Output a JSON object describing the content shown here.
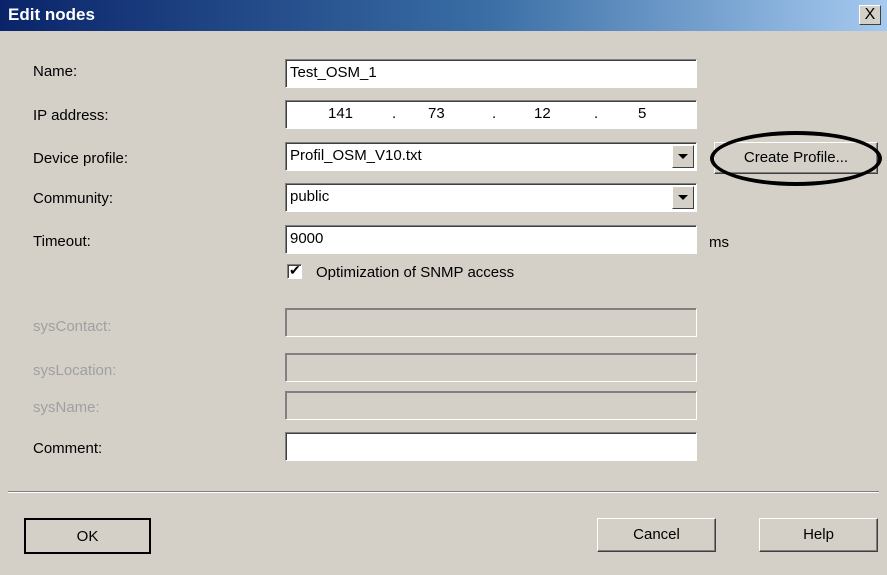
{
  "window": {
    "title": "Edit nodes",
    "close_glyph": "X"
  },
  "labels": {
    "name": "Name:",
    "ip": "IP address:",
    "device_profile": "Device profile:",
    "community": "Community:",
    "timeout": "Timeout:",
    "sys_contact": "sysContact:",
    "sys_location": "sysLocation:",
    "sys_name": "sysName:",
    "comment": "Comment:"
  },
  "fields": {
    "name": "Test_OSM_1",
    "ip": [
      "141",
      "73",
      "12",
      "5"
    ],
    "ip_dot": ".",
    "device_profile": "Profil_OSM_V10.txt",
    "community": "public",
    "timeout": "9000",
    "timeout_unit": "ms",
    "sys_contact": "",
    "sys_location": "",
    "sys_name": "",
    "comment": ""
  },
  "checkbox": {
    "label": "Optimization of SNMP access",
    "checked": true
  },
  "buttons": {
    "create_profile": "Create Profile...",
    "ok": "OK",
    "cancel": "Cancel",
    "help": "Help"
  }
}
